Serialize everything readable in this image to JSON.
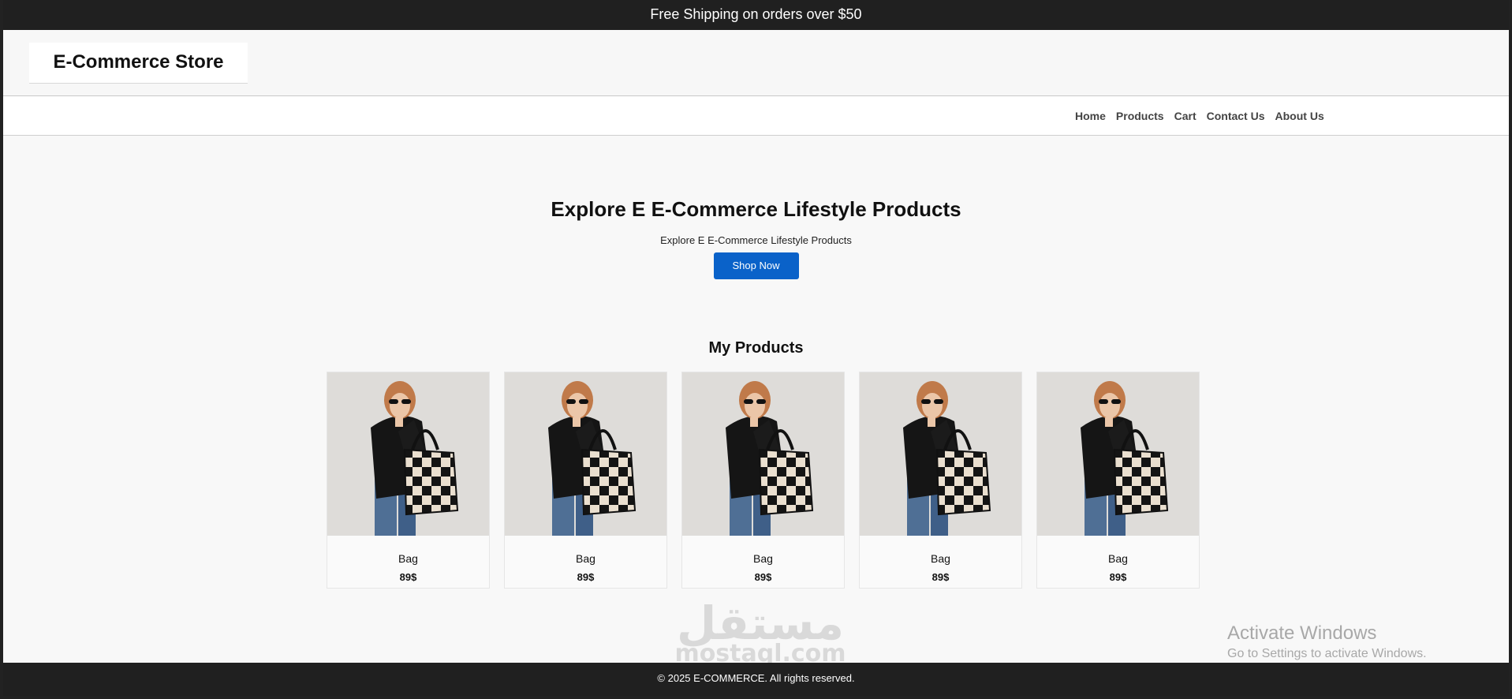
{
  "top_banner": {
    "text": "Free Shipping on orders over $50"
  },
  "header": {
    "brand": "E-Commerce Store"
  },
  "nav": {
    "items": [
      {
        "label": "Home"
      },
      {
        "label": "Products"
      },
      {
        "label": "Cart"
      },
      {
        "label": "Contact Us"
      },
      {
        "label": "About Us"
      }
    ]
  },
  "hero": {
    "title": "Explore E E-Commerce Lifestyle Products",
    "subtitle": "Explore E E-Commerce Lifestyle Products",
    "button_label": "Shop Now",
    "button_color": "#0a62c9"
  },
  "products_section": {
    "title": "My Products",
    "items": [
      {
        "name": "Bag",
        "price": "89$",
        "image": "woman-checkered-tote-bag-photo"
      },
      {
        "name": "Bag",
        "price": "89$",
        "image": "woman-checkered-tote-bag-photo"
      },
      {
        "name": "Bag",
        "price": "89$",
        "image": "woman-checkered-tote-bag-photo"
      },
      {
        "name": "Bag",
        "price": "89$",
        "image": "woman-checkered-tote-bag-photo"
      },
      {
        "name": "Bag",
        "price": "89$",
        "image": "woman-checkered-tote-bag-photo"
      }
    ]
  },
  "watermark": {
    "arabic": "مستقل",
    "latin": "mostaql.com"
  },
  "footer": {
    "text": "© 2025 E-COMMERCE. All rights reserved."
  },
  "os_overlay": {
    "title": "Activate Windows",
    "subtitle": "Go to Settings to activate Windows."
  }
}
